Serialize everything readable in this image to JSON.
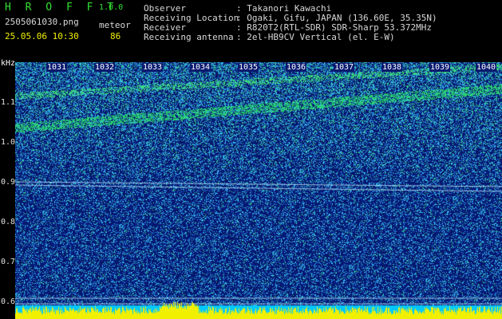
{
  "app": {
    "name": "H R O F F T",
    "version": "1.0.0"
  },
  "file": {
    "name": "2505061030.png",
    "datetime": "25.05.06 10:30"
  },
  "detector": {
    "label": "meteor",
    "count": "86"
  },
  "station": [
    {
      "key": "Observer",
      "value": ": Takanori Kawachi"
    },
    {
      "key": "Receiving Location",
      "value": ": Ogaki, Gifu, JAPAN (136.60E, 35.35N)"
    },
    {
      "key": "Receiver",
      "value": ": R820T2(RTL-SDR) SDR-Sharp 53.372MHz"
    },
    {
      "key": "Receiving antenna",
      "value": ": 2el-HB9CV Vertical (el. E-W)"
    }
  ],
  "axis": {
    "y_unit": "kHz",
    "y_ticks": [
      "1.1",
      "1.0",
      "0.9",
      "0.8",
      "0.7",
      "0.6"
    ],
    "x_ticks": [
      "1031",
      "1032",
      "1033",
      "1034",
      "1035",
      "1036",
      "1037",
      "1038",
      "1039",
      "1040"
    ]
  },
  "colors": {
    "background": "#0a1a70",
    "signal": "#33e033",
    "level_bar": "#f0f000",
    "floor": "#00c8ff"
  }
}
